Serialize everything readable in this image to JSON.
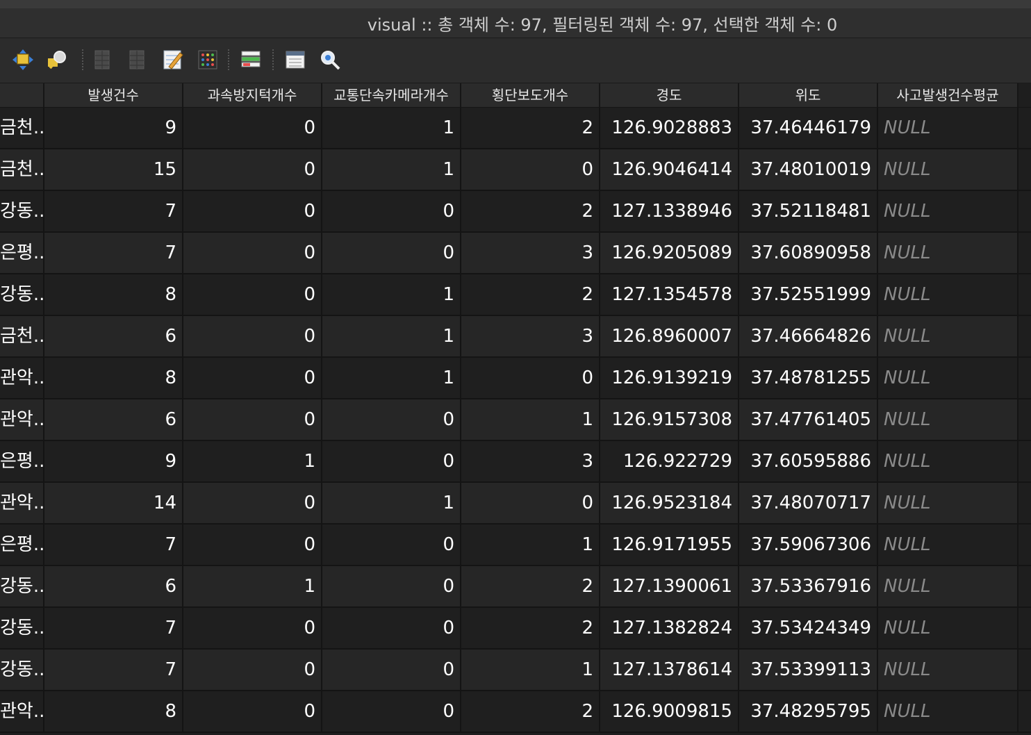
{
  "window": {
    "title": "visual :: 총 객체 수: 97, 필터링된 객체 수: 97, 선택한 객체 수: 0"
  },
  "toolbar": {
    "icons": [
      "move-selection-icon",
      "zoom-to-selection-icon",
      "delete-column-icon",
      "new-column-icon",
      "edit-table-icon",
      "field-calculator-icon",
      "conditional-format-icon",
      "form-view-icon",
      "zoom-map-icon"
    ]
  },
  "table": {
    "columns": [
      "",
      "발생건수",
      "과속방지턱개수",
      "교통단속카메라개수",
      "횡단보도개수",
      "경도",
      "위도",
      "사고발생건수평균"
    ],
    "rows": [
      [
        "금천...",
        "9",
        "0",
        "1",
        "2",
        "126.9028883",
        "37.46446179",
        "NULL"
      ],
      [
        "금천...",
        "15",
        "0",
        "1",
        "0",
        "126.9046414",
        "37.48010019",
        "NULL"
      ],
      [
        "강동...",
        "7",
        "0",
        "0",
        "2",
        "127.1338946",
        "37.52118481",
        "NULL"
      ],
      [
        "은평...",
        "7",
        "0",
        "0",
        "3",
        "126.9205089",
        "37.60890958",
        "NULL"
      ],
      [
        "강동...",
        "8",
        "0",
        "1",
        "2",
        "127.1354578",
        "37.52551999",
        "NULL"
      ],
      [
        "금천...",
        "6",
        "0",
        "1",
        "3",
        "126.8960007",
        "37.46664826",
        "NULL"
      ],
      [
        "관악...",
        "8",
        "0",
        "1",
        "0",
        "126.9139219",
        "37.48781255",
        "NULL"
      ],
      [
        "관악...",
        "6",
        "0",
        "0",
        "1",
        "126.9157308",
        "37.47761405",
        "NULL"
      ],
      [
        "은평...",
        "9",
        "1",
        "0",
        "3",
        "126.922729",
        "37.60595886",
        "NULL"
      ],
      [
        "관악...",
        "14",
        "0",
        "1",
        "0",
        "126.9523184",
        "37.48070717",
        "NULL"
      ],
      [
        "은평...",
        "7",
        "0",
        "0",
        "1",
        "126.9171955",
        "37.59067306",
        "NULL"
      ],
      [
        "강동...",
        "6",
        "1",
        "0",
        "2",
        "127.1390061",
        "37.53367916",
        "NULL"
      ],
      [
        "강동...",
        "7",
        "0",
        "0",
        "2",
        "127.1382824",
        "37.53424349",
        "NULL"
      ],
      [
        "강동...",
        "7",
        "0",
        "0",
        "1",
        "127.1378614",
        "37.53399113",
        "NULL"
      ],
      [
        "관악...",
        "8",
        "0",
        "0",
        "2",
        "126.9009815",
        "37.48295795",
        "NULL"
      ]
    ]
  }
}
